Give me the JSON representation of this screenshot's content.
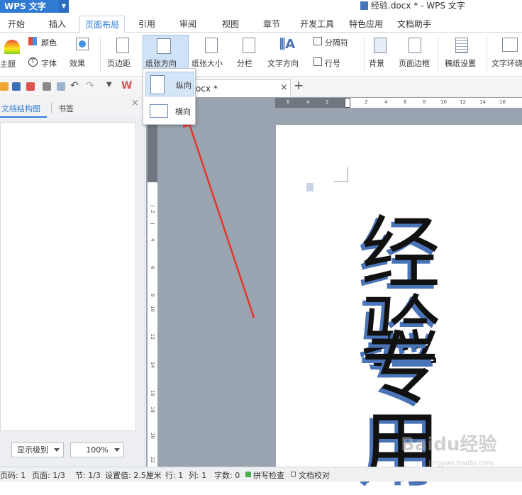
{
  "titlebar": {
    "app_button": "WPS 文字",
    "doc_title": "经验.docx * - WPS 文字"
  },
  "tabs": [
    "开始",
    "插入",
    "页面布局",
    "引用",
    "审阅",
    "视图",
    "章节",
    "开发工具",
    "特色应用",
    "文档助手"
  ],
  "active_tab": "页面布局",
  "ribbon": {
    "theme": "主题",
    "color": "颜色",
    "font": "字体",
    "effect": "效果",
    "margins": "页边距",
    "orientation": "纸张方向",
    "size": "纸张大小",
    "columns": "分栏",
    "text_direction": "文字方向",
    "breaks": "分隔符",
    "line_numbers": "行号",
    "background": "背景",
    "page_border": "页面边框",
    "manuscript": "稿纸设置",
    "text_wrap": "文字环绕"
  },
  "orientation_menu": {
    "portrait": "纵向",
    "landscape": "横向"
  },
  "doc_tab": {
    "label": "ocx *"
  },
  "left_panel": {
    "tab_outline": "文档结构图",
    "tab_bookmark": "书签",
    "level_select": "显示级别",
    "zoom_select": "100%"
  },
  "ruler": {
    "h_ticks": [
      "6",
      "4",
      "2",
      "2",
      "4",
      "6",
      "8",
      "10",
      "12",
      "14",
      "16"
    ],
    "v_ticks": [
      "2",
      "4",
      "6",
      "8",
      "10",
      "12",
      "14",
      "16",
      "18",
      "20",
      "22"
    ]
  },
  "document": {
    "line1": "经验",
    "line2": "专用"
  },
  "status": {
    "page_num": "页码: 1",
    "pages": "页面: 1/3",
    "section": "节: 1/3",
    "setting": "设置值: 2.5厘米",
    "row": "行: 1",
    "col": "列: 1",
    "words": "字数: 0",
    "spell": "拼写检查",
    "proof": "文档校对"
  },
  "watermark": {
    "main": "Baidu经验",
    "sub": "jingyan.baidu.com"
  },
  "colors": {
    "accent": "#2f7bd4",
    "arrow": "#e8332f",
    "text_shadow": "#4a74b8"
  }
}
